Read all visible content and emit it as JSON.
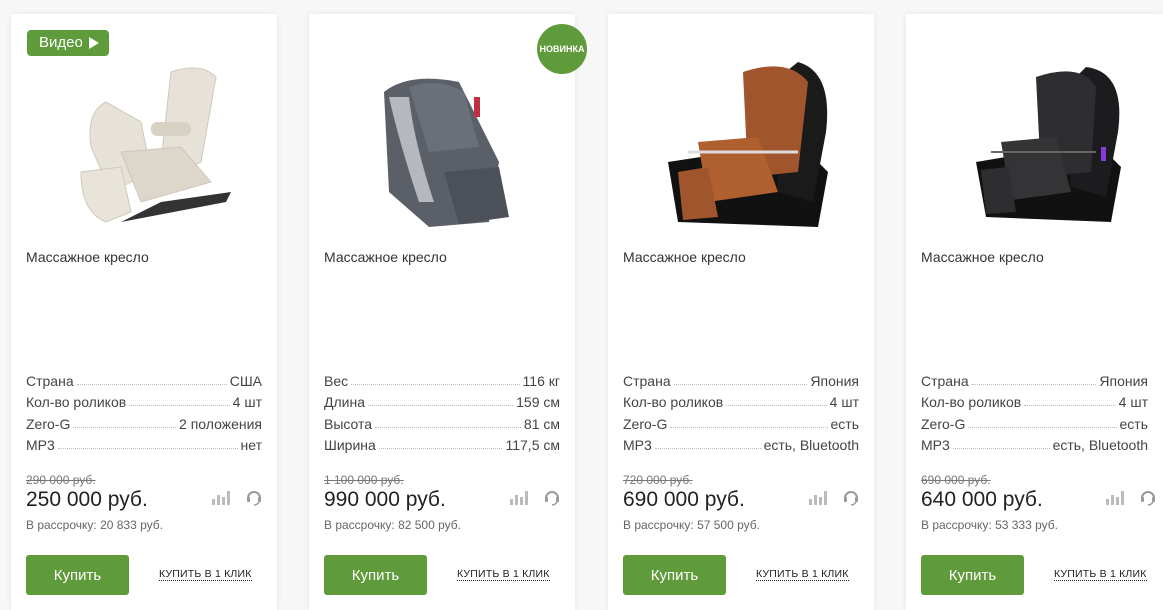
{
  "cards": [
    {
      "badge_video": "Видео",
      "name": "Массажное кресло",
      "specs": [
        {
          "k": "Страна",
          "v": "США"
        },
        {
          "k": "Кол-во роликов",
          "v": "4 шт"
        },
        {
          "k": "Zero-G",
          "v": "2 положения"
        },
        {
          "k": "MP3",
          "v": "нет"
        }
      ],
      "old_price": "290 000 руб.",
      "price": "250 000 руб.",
      "credit": "В рассрочку: 20 833 руб.",
      "buy": "Купить",
      "oneclick": "купить в 1 клик",
      "chair_color": "#e7e2d8"
    },
    {
      "badge_new": "НОВИНКА",
      "name": "Массажное кресло",
      "specs": [
        {
          "k": "Вес",
          "v": "116 кг"
        },
        {
          "k": "Длина",
          "v": "159 см"
        },
        {
          "k": "Высота",
          "v": "81 см"
        },
        {
          "k": "Ширина",
          "v": "117,5 см"
        }
      ],
      "old_price": "1 100 000 руб.",
      "price": "990 000 руб.",
      "credit": "В рассрочку: 82 500 руб.",
      "buy": "Купить",
      "oneclick": "купить в 1 клик",
      "chair_color": "#5b6068"
    },
    {
      "name": "Массажное кресло",
      "specs": [
        {
          "k": "Страна",
          "v": "Япония"
        },
        {
          "k": "Кол-во роликов",
          "v": "4 шт"
        },
        {
          "k": "Zero-G",
          "v": "есть"
        },
        {
          "k": "MP3",
          "v": "есть, Bluetooth"
        }
      ],
      "old_price": "720 000 руб.",
      "price": "690 000 руб.",
      "credit": "В рассрочку: 57 500 руб.",
      "buy": "Купить",
      "oneclick": "купить в 1 клик",
      "chair_color": "#a0552c"
    },
    {
      "name": "Массажное кресло",
      "specs": [
        {
          "k": "Страна",
          "v": "Япония"
        },
        {
          "k": "Кол-во роликов",
          "v": "4 шт"
        },
        {
          "k": "Zero-G",
          "v": "есть"
        },
        {
          "k": "MP3",
          "v": "есть, Bluetooth"
        }
      ],
      "old_price": "690 000 руб.",
      "price": "640 000 руб.",
      "credit": "В рассрочку: 53 333 руб.",
      "buy": "Купить",
      "oneclick": "купить в 1 клик",
      "chair_color": "#2e2e30"
    }
  ],
  "colors": {
    "accent": "#5f9b3a"
  },
  "icons": [
    "compare-icon",
    "support-headset-icon"
  ]
}
